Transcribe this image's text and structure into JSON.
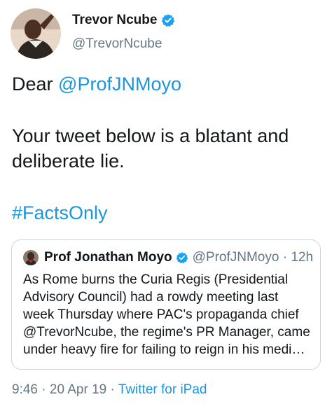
{
  "author": {
    "name": "Trevor Ncube",
    "handle": "@TrevorNcube",
    "verified_icon": "verified-badge-icon"
  },
  "tweet": {
    "line1_prefix": "Dear ",
    "line1_mention": "@ProfJNMoyo",
    "line2": "Your tweet below is a blatant and",
    "line3": "deliberate lie.",
    "hashtag": "#FactsOnly"
  },
  "quoted_tweet": {
    "name": "Prof Jonathan Moyo",
    "handle": "@ProfJNMoyo",
    "separator": " · ",
    "time": "12h",
    "lines": [
      "As Rome burns the Curia Regis (Presidential",
      "Advisory Council) had a rowdy meeting last",
      "week Thursday where PAC's propaganda chief",
      "@TrevorNcube, the regime's PR Manager, came",
      "under heavy fire for failing to reign in his medi…"
    ]
  },
  "footer": {
    "time": "9:46",
    "sep1": " · ",
    "date": "20 Apr 19",
    "sep2": " · ",
    "source": "Twitter for iPad"
  },
  "colors": {
    "link": "#1b95e0",
    "secondary_text": "#657786",
    "border": "#ccd6dd",
    "verified": "#1da1f2"
  }
}
